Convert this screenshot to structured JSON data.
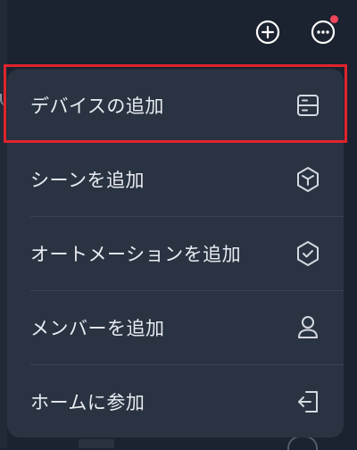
{
  "header": {
    "add_icon": "plus-circle-icon",
    "more_icon": "more-horizontal-circle-icon",
    "notification_color": "#f0455a"
  },
  "menu": {
    "items": [
      {
        "label": "デバイスの追加",
        "icon": "device-icon"
      },
      {
        "label": "シーンを追加",
        "icon": "cube-icon"
      },
      {
        "label": "オートメーションを追加",
        "icon": "shield-check-icon"
      },
      {
        "label": "メンバーを追加",
        "icon": "person-icon"
      },
      {
        "label": "ホームに参加",
        "icon": "enter-icon"
      }
    ],
    "highlight_color": "#e0242c"
  }
}
